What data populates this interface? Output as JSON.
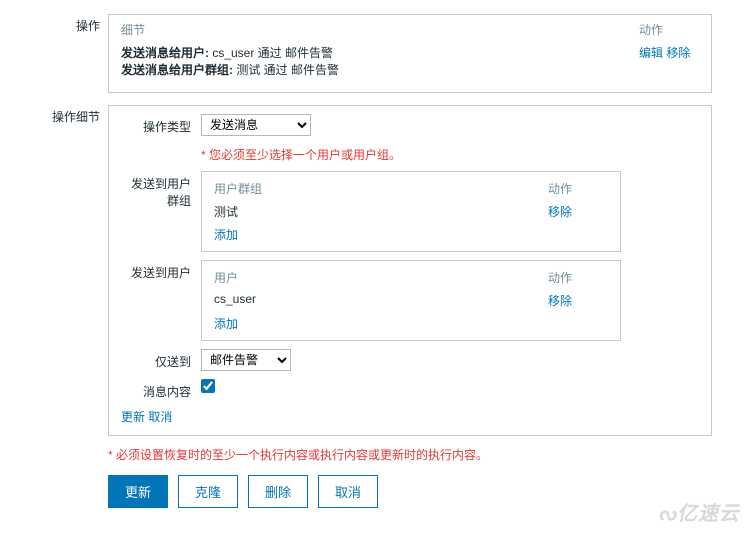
{
  "operations": {
    "label": "操作",
    "header_detail": "细节",
    "header_action": "动作",
    "rows": [
      {
        "prefix": "发送消息给用户:",
        "text": " cs_user 通过 邮件告警"
      },
      {
        "prefix": "发送消息给用户群组:",
        "text": " 测试 通过 邮件告警"
      }
    ],
    "edit": "编辑",
    "remove": "移除"
  },
  "details": {
    "label": "操作细节",
    "op_type_label": "操作类型",
    "op_type_value": "发送消息",
    "required_hint": "您必须至少选择一个用户或用户组。",
    "send_group_label": "发送到用户群组",
    "group_header": "用户群组",
    "action_header": "动作",
    "group_item": "测试",
    "group_remove": "移除",
    "group_add": "添加",
    "send_user_label": "发送到用户",
    "user_header": "用户",
    "user_item": "cs_user",
    "user_remove": "移除",
    "user_add": "添加",
    "only_send_label": "仅送到",
    "only_send_value": "邮件告警",
    "msg_content_label": "消息内容",
    "update_link": "更新",
    "cancel_link": "取消"
  },
  "footer_hint": "必须设置恢复时的至少一个执行内容或执行内容或更新时的执行内容。",
  "buttons": {
    "update": "更新",
    "clone": "克隆",
    "delete": "删除",
    "cancel": "取消"
  },
  "watermark": "亿速云"
}
